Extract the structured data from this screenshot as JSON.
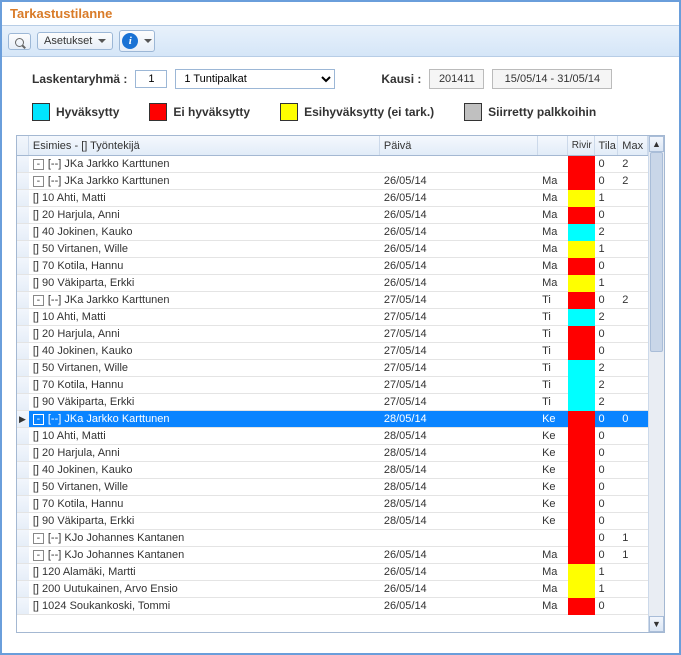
{
  "title": "Tarkastustilanne",
  "toolbar": {
    "settings_label": "Asetukset"
  },
  "filters": {
    "group_label": "Laskentaryhmä :",
    "group_value": "1",
    "group_select": "1 Tuntipalkat",
    "period_label": "Kausi :",
    "period_value": "201411",
    "period_range": "15/05/14 - 31/05/14"
  },
  "legend": {
    "approved": "Hyväksytty",
    "rejected": "Ei hyväksytty",
    "preapproved": "Esihyväksytty (ei tark.)",
    "transferred": "Siirretty palkkoihin"
  },
  "columns": {
    "name": "Esimies - [] Työntekijä",
    "day": "Päivä",
    "dow": "",
    "status": "Rivir",
    "tila": "Tila",
    "max": "Max"
  },
  "status_colors": {
    "red": "#ff0000",
    "cyan": "#00ffff",
    "yellow": "#ffff00",
    "gray": "#c0c0c0"
  },
  "rows": [
    {
      "indent": 0,
      "expand": "-",
      "name": "[--] JKa Jarkko Karttunen",
      "day": "",
      "dow": "",
      "status": "red",
      "tila": "0",
      "max": "2",
      "selected": false
    },
    {
      "indent": 1,
      "expand": "-",
      "name": "[--] JKa Jarkko Karttunen",
      "day": "26/05/14",
      "dow": "Ma",
      "status": "red",
      "tila": "0",
      "max": "2",
      "selected": false
    },
    {
      "indent": 2,
      "expand": "",
      "name": "[] 10 Ahti, Matti",
      "day": "26/05/14",
      "dow": "Ma",
      "status": "yellow",
      "tila": "1",
      "max": "",
      "selected": false
    },
    {
      "indent": 2,
      "expand": "",
      "name": "[] 20 Harjula, Anni",
      "day": "26/05/14",
      "dow": "Ma",
      "status": "red",
      "tila": "0",
      "max": "",
      "selected": false
    },
    {
      "indent": 2,
      "expand": "",
      "name": "[] 40 Jokinen, Kauko",
      "day": "26/05/14",
      "dow": "Ma",
      "status": "cyan",
      "tila": "2",
      "max": "",
      "selected": false
    },
    {
      "indent": 2,
      "expand": "",
      "name": "[] 50 Virtanen, Wille",
      "day": "26/05/14",
      "dow": "Ma",
      "status": "yellow",
      "tila": "1",
      "max": "",
      "selected": false
    },
    {
      "indent": 2,
      "expand": "",
      "name": "[] 70 Kotila, Hannu",
      "day": "26/05/14",
      "dow": "Ma",
      "status": "red",
      "tila": "0",
      "max": "",
      "selected": false
    },
    {
      "indent": 2,
      "expand": "",
      "name": "[] 90 Väkiparta, Erkki",
      "day": "26/05/14",
      "dow": "Ma",
      "status": "yellow",
      "tila": "1",
      "max": "",
      "selected": false
    },
    {
      "indent": 1,
      "expand": "-",
      "name": "[--] JKa Jarkko Karttunen",
      "day": "27/05/14",
      "dow": "Ti",
      "status": "red",
      "tila": "0",
      "max": "2",
      "selected": false
    },
    {
      "indent": 2,
      "expand": "",
      "name": "[] 10 Ahti, Matti",
      "day": "27/05/14",
      "dow": "Ti",
      "status": "cyan",
      "tila": "2",
      "max": "",
      "selected": false
    },
    {
      "indent": 2,
      "expand": "",
      "name": "[] 20 Harjula, Anni",
      "day": "27/05/14",
      "dow": "Ti",
      "status": "red",
      "tila": "0",
      "max": "",
      "selected": false
    },
    {
      "indent": 2,
      "expand": "",
      "name": "[] 40 Jokinen, Kauko",
      "day": "27/05/14",
      "dow": "Ti",
      "status": "red",
      "tila": "0",
      "max": "",
      "selected": false
    },
    {
      "indent": 2,
      "expand": "",
      "name": "[] 50 Virtanen, Wille",
      "day": "27/05/14",
      "dow": "Ti",
      "status": "cyan",
      "tila": "2",
      "max": "",
      "selected": false
    },
    {
      "indent": 2,
      "expand": "",
      "name": "[] 70 Kotila, Hannu",
      "day": "27/05/14",
      "dow": "Ti",
      "status": "cyan",
      "tila": "2",
      "max": "",
      "selected": false
    },
    {
      "indent": 2,
      "expand": "",
      "name": "[] 90 Väkiparta, Erkki",
      "day": "27/05/14",
      "dow": "Ti",
      "status": "cyan",
      "tila": "2",
      "max": "",
      "selected": false
    },
    {
      "indent": 1,
      "expand": "-",
      "name": "[--] JKa Jarkko Karttunen",
      "day": "28/05/14",
      "dow": "Ke",
      "status": "red",
      "tila": "0",
      "max": "0",
      "selected": true,
      "arrow": true
    },
    {
      "indent": 2,
      "expand": "",
      "name": "[] 10 Ahti, Matti",
      "day": "28/05/14",
      "dow": "Ke",
      "status": "red",
      "tila": "0",
      "max": "",
      "selected": false
    },
    {
      "indent": 2,
      "expand": "",
      "name": "[] 20 Harjula, Anni",
      "day": "28/05/14",
      "dow": "Ke",
      "status": "red",
      "tila": "0",
      "max": "",
      "selected": false
    },
    {
      "indent": 2,
      "expand": "",
      "name": "[] 40 Jokinen, Kauko",
      "day": "28/05/14",
      "dow": "Ke",
      "status": "red",
      "tila": "0",
      "max": "",
      "selected": false
    },
    {
      "indent": 2,
      "expand": "",
      "name": "[] 50 Virtanen, Wille",
      "day": "28/05/14",
      "dow": "Ke",
      "status": "red",
      "tila": "0",
      "max": "",
      "selected": false
    },
    {
      "indent": 2,
      "expand": "",
      "name": "[] 70 Kotila, Hannu",
      "day": "28/05/14",
      "dow": "Ke",
      "status": "red",
      "tila": "0",
      "max": "",
      "selected": false
    },
    {
      "indent": 2,
      "expand": "",
      "name": "[] 90 Väkiparta, Erkki",
      "day": "28/05/14",
      "dow": "Ke",
      "status": "red",
      "tila": "0",
      "max": "",
      "selected": false
    },
    {
      "indent": 0,
      "expand": "-",
      "name": "[--] KJo Johannes Kantanen",
      "day": "",
      "dow": "",
      "status": "red",
      "tila": "0",
      "max": "1",
      "selected": false
    },
    {
      "indent": 1,
      "expand": "-",
      "name": "[--] KJo Johannes Kantanen",
      "day": "26/05/14",
      "dow": "Ma",
      "status": "red",
      "tila": "0",
      "max": "1",
      "selected": false
    },
    {
      "indent": 2,
      "expand": "",
      "name": "[] 120 Alamäki, Martti",
      "day": "26/05/14",
      "dow": "Ma",
      "status": "yellow",
      "tila": "1",
      "max": "",
      "selected": false
    },
    {
      "indent": 2,
      "expand": "",
      "name": "[] 200 Uutukainen, Arvo Ensio",
      "day": "26/05/14",
      "dow": "Ma",
      "status": "yellow",
      "tila": "1",
      "max": "",
      "selected": false
    },
    {
      "indent": 2,
      "expand": "",
      "name": "[] 1024 Soukankoski, Tommi",
      "day": "26/05/14",
      "dow": "Ma",
      "status": "red",
      "tila": "0",
      "max": "",
      "selected": false
    }
  ]
}
